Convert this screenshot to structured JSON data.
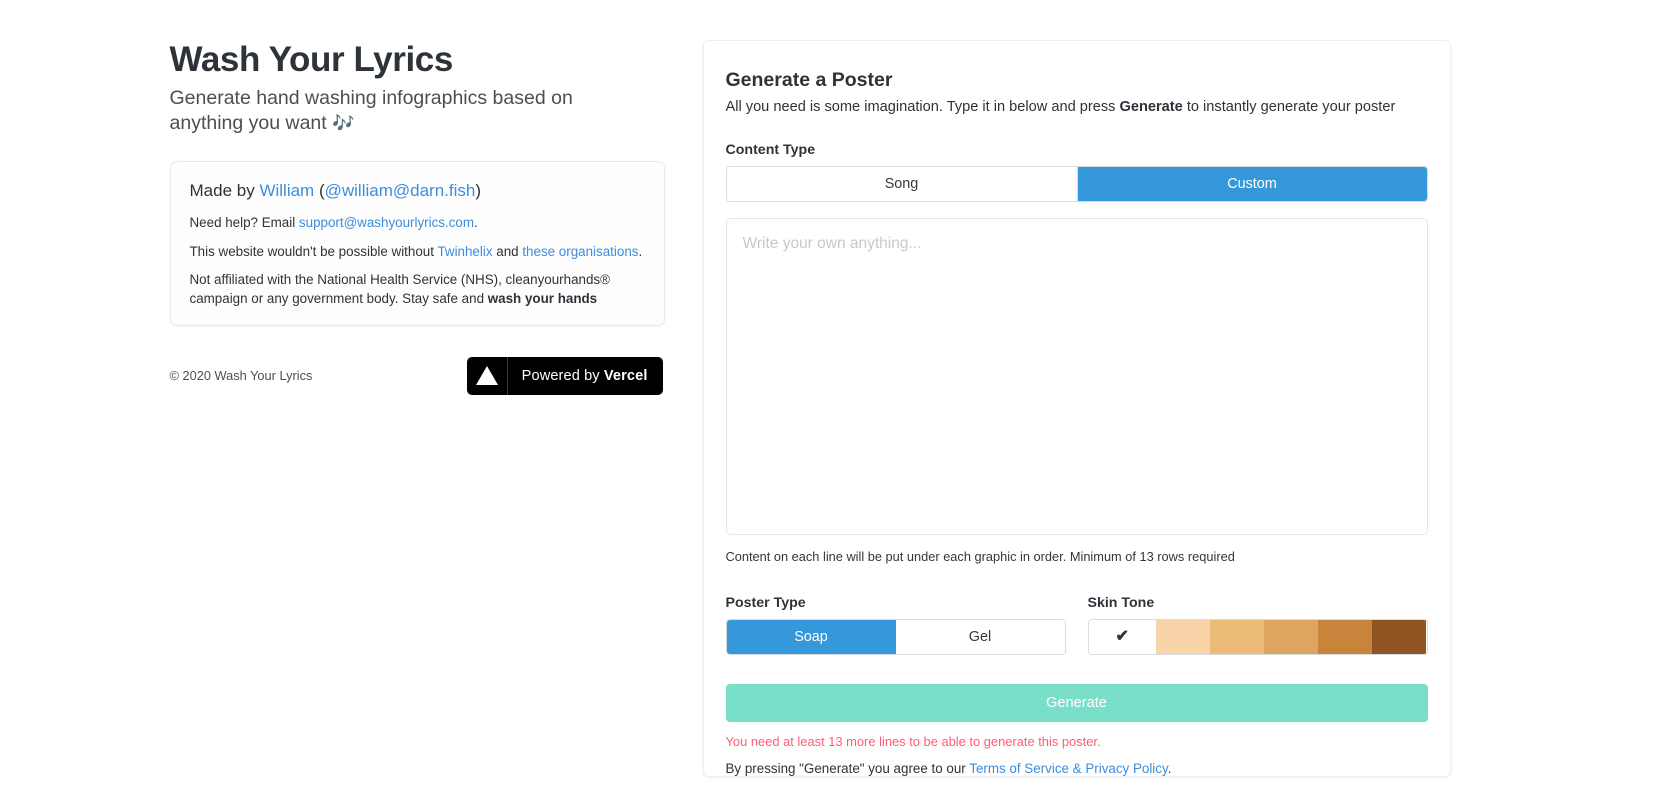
{
  "left": {
    "title": "Wash Your Lyrics",
    "tagline": "Generate hand washing infographics based on anything you want",
    "tagline_emoji": "🎶",
    "card": {
      "made_by_prefix": "Made by ",
      "made_by_name": "William",
      "made_by_open": " (",
      "made_by_handle": "@william@darn.fish",
      "made_by_close": ")",
      "help_prefix": "Need help? Email ",
      "help_email": "support@washyourlyrics.com",
      "help_suffix": ".",
      "thanks_prefix": "This website wouldn't be possible without ",
      "thanks_link1": "Twinhelix",
      "thanks_mid": " and ",
      "thanks_link2": "these organisations",
      "thanks_suffix": ".",
      "disclaimer_part1": "Not affiliated with the National Health Service (NHS), cleanyourhands® campaign or any government body. Stay safe and ",
      "disclaimer_bold": "wash your hands"
    },
    "copyright": "© 2020 Wash Your Lyrics",
    "vercel": {
      "prefix": "Powered by ",
      "brand": "Vercel",
      "logo_icon": "vercel-triangle-icon"
    }
  },
  "panel": {
    "title": "Generate a Poster",
    "subtitle_part1": "All you need is some imagination. Type it in below and press ",
    "subtitle_bold": "Generate",
    "subtitle_part2": " to instantly generate your poster",
    "content_type": {
      "label": "Content Type",
      "options": [
        "Song",
        "Custom"
      ],
      "selected": "Custom"
    },
    "lyrics_input": {
      "placeholder": "Write your own anything...",
      "value": "",
      "helper": "Content on each line will be put under each graphic in order. Minimum of 13 rows required"
    },
    "poster_type": {
      "label": "Poster Type",
      "options": [
        "Soap",
        "Gel"
      ],
      "selected": "Soap"
    },
    "skin_tone": {
      "label": "Skin Tone",
      "selected_index": 0,
      "check_icon": "✔",
      "swatches": [
        "#ffffff",
        "#f9d4a8",
        "#edbb78",
        "#dda55f",
        "#c8843b",
        "#8f5522"
      ]
    },
    "generate": {
      "label": "Generate",
      "color": "#79dfc9",
      "warning": "You need at least 13 more lines to be able to generate this poster.",
      "warning_color": "#ff5d72"
    },
    "terms": {
      "prefix": "By pressing \"Generate\" you agree to our ",
      "link": "Terms of Service & Privacy Policy",
      "suffix": "."
    }
  },
  "colors": {
    "accent_blue": "#3498db",
    "link_blue": "#3b8ede"
  }
}
